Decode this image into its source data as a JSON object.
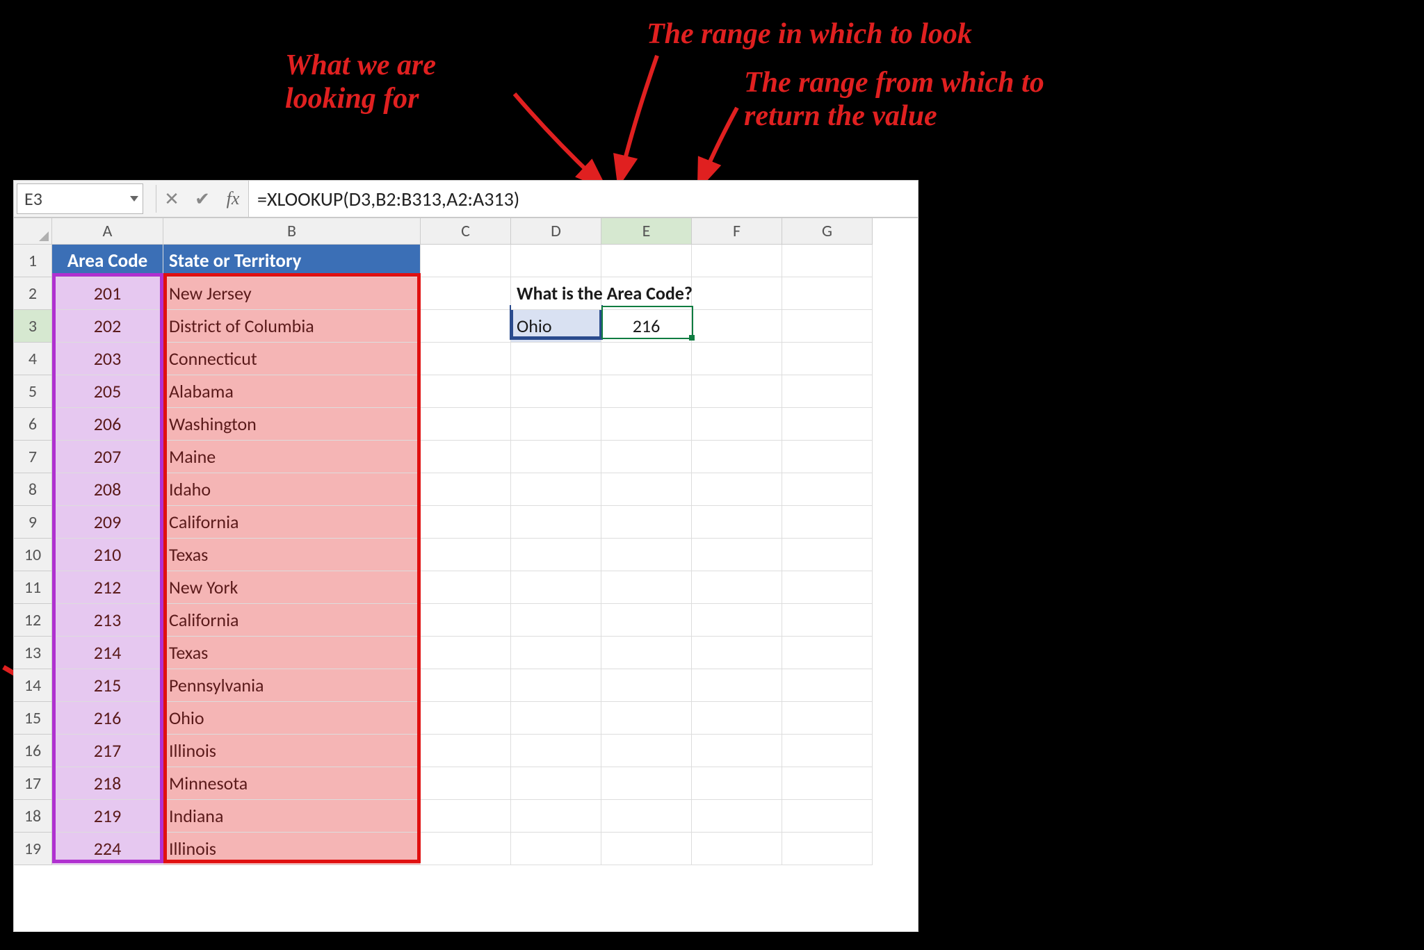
{
  "annotations": {
    "lookFor": "What we are\nlooking for",
    "lookRange": "The range in which to look",
    "returnRange": "The range from which to\nreturn the value"
  },
  "formulaBar": {
    "nameBox": "E3",
    "cancelIcon": "✕",
    "enterIcon": "✔",
    "fxLabel": "fx",
    "formula": "=XLOOKUP(D3,B2:B313,A2:A313)"
  },
  "columnHeaders": [
    "A",
    "B",
    "C",
    "D",
    "E",
    "F",
    "G"
  ],
  "rowNumbers": [
    "1",
    "2",
    "3",
    "4",
    "5",
    "6",
    "7",
    "8",
    "9",
    "10",
    "11",
    "12",
    "13",
    "14",
    "15",
    "16",
    "17",
    "18",
    "19"
  ],
  "tableHeader": {
    "colA": "Area Code",
    "colB": "State or Territory"
  },
  "rows": [
    {
      "code": "201",
      "state": "New Jersey"
    },
    {
      "code": "202",
      "state": "District of Columbia"
    },
    {
      "code": "203",
      "state": "Connecticut"
    },
    {
      "code": "205",
      "state": "Alabama"
    },
    {
      "code": "206",
      "state": "Washington"
    },
    {
      "code": "207",
      "state": "Maine"
    },
    {
      "code": "208",
      "state": "Idaho"
    },
    {
      "code": "209",
      "state": "California"
    },
    {
      "code": "210",
      "state": "Texas"
    },
    {
      "code": "212",
      "state": "New York"
    },
    {
      "code": "213",
      "state": "California"
    },
    {
      "code": "214",
      "state": "Texas"
    },
    {
      "code": "215",
      "state": "Pennsylvania"
    },
    {
      "code": "216",
      "state": "Ohio"
    },
    {
      "code": "217",
      "state": "Illinois"
    },
    {
      "code": "218",
      "state": "Minnesota"
    },
    {
      "code": "219",
      "state": "Indiana"
    },
    {
      "code": "224",
      "state": "Illinois"
    }
  ],
  "question": {
    "label": "What is the Area Code?",
    "lookupValue": "Ohio",
    "result": "216"
  }
}
